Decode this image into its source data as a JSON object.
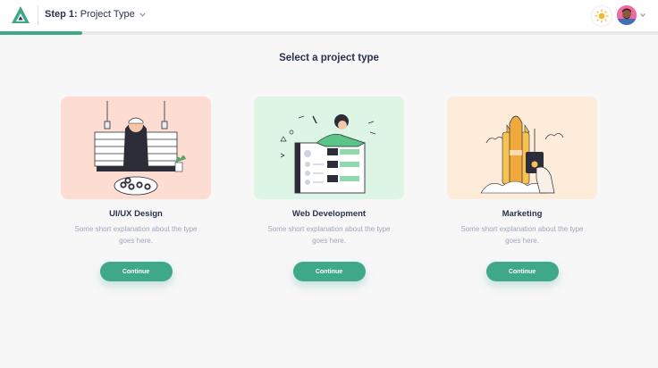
{
  "header": {
    "step_label": "Step 1:",
    "step_name": "Project Type",
    "progress_fraction": 0.125
  },
  "main": {
    "title": "Select a project type",
    "cards": [
      {
        "title": "UI/UX Design",
        "description": "Some short explanation about the type goes here.",
        "button_label": "Continue",
        "background": "#fddcd1",
        "illustration": "sushi-chef-illustration"
      },
      {
        "title": "Web Development",
        "description": "Some short explanation about the type goes here.",
        "button_label": "Continue",
        "background": "#dcf5e4",
        "illustration": "web-developer-illustration"
      },
      {
        "title": "Marketing",
        "description": "Some short explanation about the type goes here.",
        "button_label": "Continue",
        "background": "#fcecd9",
        "illustration": "rocket-launch-illustration"
      }
    ]
  },
  "colors": {
    "accent": "#3fa987",
    "text": "#283252",
    "muted": "#a2a5b9"
  },
  "icons": {
    "logo": "logo-icon",
    "theme": "sun-icon",
    "dropdown": "chevron-down-icon"
  }
}
